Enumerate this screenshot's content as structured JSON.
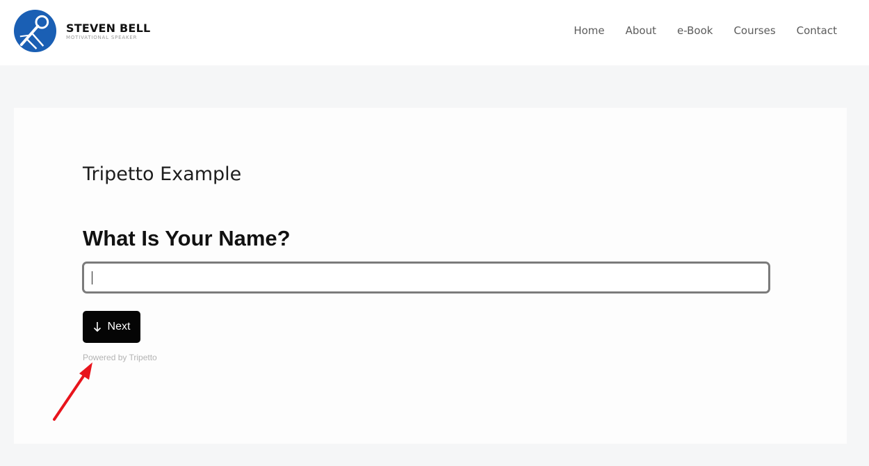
{
  "header": {
    "brand_name": "STEVEN BELL",
    "brand_tagline": "MOTIVATIONAL SPEAKER",
    "logo_icon": "microphone-icon",
    "nav": [
      {
        "label": "Home"
      },
      {
        "label": "About"
      },
      {
        "label": "e-Book"
      },
      {
        "label": "Courses"
      },
      {
        "label": "Contact"
      }
    ]
  },
  "form": {
    "title": "Tripetto Example",
    "question": "What Is Your Name?",
    "name_value": "",
    "next_label": "Next",
    "next_icon": "arrow-down-icon",
    "powered_by": "Powered by Tripetto"
  },
  "colors": {
    "brand_blue": "#1a5fb4",
    "button_bg": "#050505",
    "annotation_arrow": "#e8141c"
  }
}
